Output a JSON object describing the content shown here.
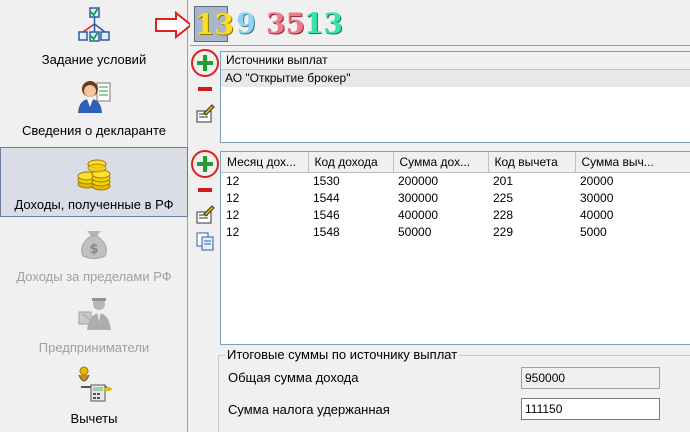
{
  "nav": {
    "items": [
      {
        "label": "Задание условий",
        "icon": "conditions-flowchart-icon",
        "state": "normal"
      },
      {
        "label": "Сведения о декларанте",
        "icon": "declarant-person-icon",
        "state": "normal"
      },
      {
        "label": "Доходы, полученные в РФ",
        "icon": "coins-icon",
        "state": "selected"
      },
      {
        "label": "Доходы за пределами РФ",
        "icon": "money-bag-icon",
        "state": "disabled"
      },
      {
        "label": "Предприниматели",
        "icon": "entrepreneur-icon",
        "state": "disabled"
      },
      {
        "label": "Вычеты",
        "icon": "deductions-scales-icon",
        "state": "normal"
      }
    ]
  },
  "rates": {
    "items": [
      {
        "label": "13",
        "selected": true,
        "color": "#ffde1e"
      },
      {
        "label": "9",
        "selected": false,
        "color": "#8fd3ef"
      },
      {
        "label": "35",
        "selected": false,
        "color": "#f17a8a"
      },
      {
        "label": "13",
        "selected": false,
        "color": "#3be4a5"
      }
    ]
  },
  "sources": {
    "header": "Источники выплат",
    "rows": [
      "АО \"Открытие брокер\""
    ],
    "toolbar": [
      "add-icon",
      "remove-icon",
      "edit-icon"
    ]
  },
  "income": {
    "columns": [
      "Месяц дох...",
      "Код дохода",
      "Сумма дох...",
      "Код вычета",
      "Сумма выч..."
    ],
    "rows": [
      [
        "12",
        "1530",
        "200000",
        "201",
        "20000"
      ],
      [
        "12",
        "1544",
        "300000",
        "225",
        "30000"
      ],
      [
        "12",
        "1546",
        "400000",
        "228",
        "40000"
      ],
      [
        "12",
        "1548",
        "50000",
        "229",
        "5000"
      ]
    ],
    "toolbar": [
      "add-icon",
      "remove-icon",
      "edit-icon",
      "copy-icon"
    ]
  },
  "totals": {
    "title": "Итоговые суммы по источнику выплат",
    "total_income_label": "Общая сумма дохода",
    "total_income_value": "950000",
    "tax_withheld_label": "Сумма налога удержанная",
    "tax_withheld_value": "111150"
  },
  "colors": {
    "annotation_red": "#e02020",
    "selection_bg": "#dadde6",
    "add_green": "#1e9e2e",
    "remove_red": "#d11a1a"
  }
}
